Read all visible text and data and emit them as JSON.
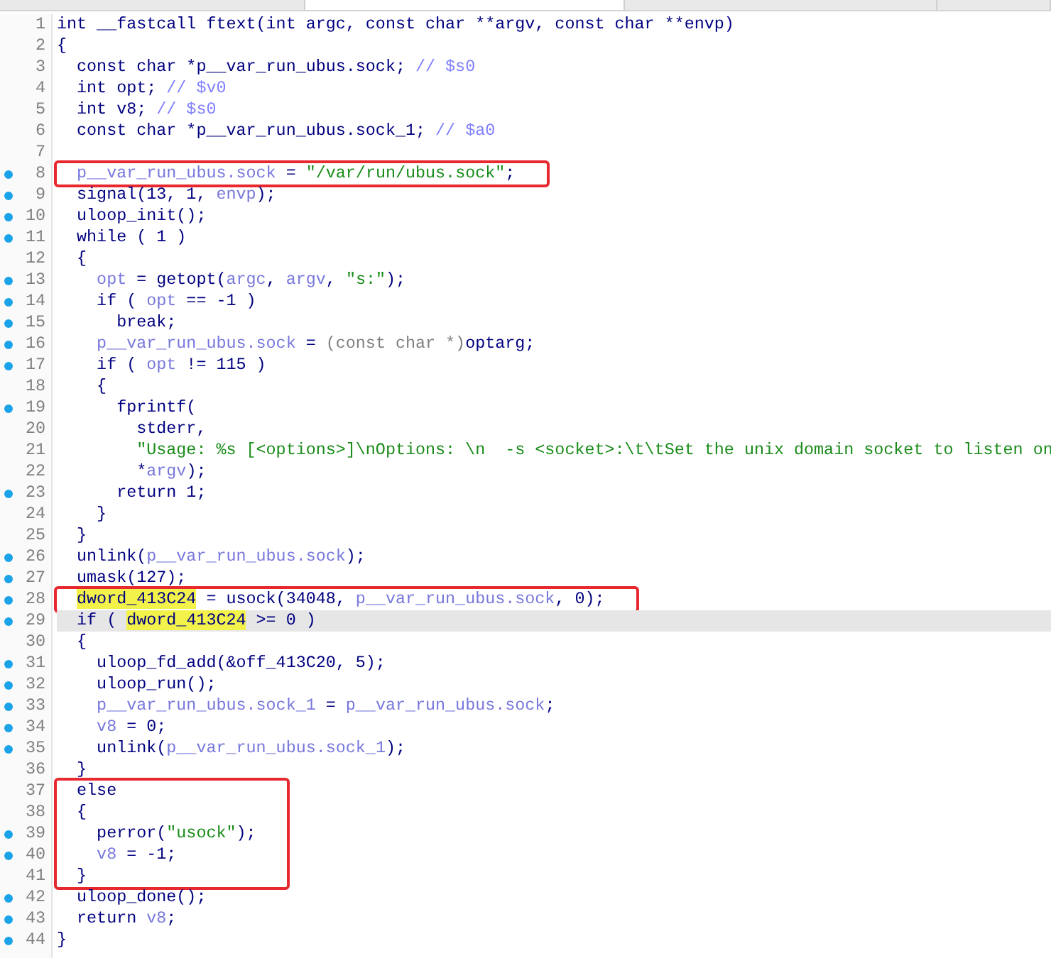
{
  "tabs": [
    {
      "selected": false
    },
    {
      "selected": true
    },
    {
      "selected": false
    },
    {
      "selected": false
    }
  ],
  "code": {
    "segments": [
      {
        "boxed": false,
        "lines": [
          {
            "number": "1",
            "breakpoint": false,
            "current": false,
            "tokens": [
              {
                "kind": "code",
                "text": "int __fastcall ftext(int argc, const char **argv, const char **envp)"
              }
            ]
          },
          {
            "number": "2",
            "breakpoint": false,
            "current": false,
            "tokens": [
              {
                "kind": "code",
                "text": "{"
              }
            ]
          },
          {
            "number": "3",
            "breakpoint": false,
            "current": false,
            "tokens": [
              {
                "kind": "code",
                "text": "  const char *p__var_run_ubus.sock; "
              },
              {
                "kind": "comment",
                "text": "// $s0"
              }
            ]
          },
          {
            "number": "4",
            "breakpoint": false,
            "current": false,
            "tokens": [
              {
                "kind": "code",
                "text": "  int opt; "
              },
              {
                "kind": "comment",
                "text": "// $v0"
              }
            ]
          },
          {
            "number": "5",
            "breakpoint": false,
            "current": false,
            "tokens": [
              {
                "kind": "code",
                "text": "  int v8; "
              },
              {
                "kind": "comment",
                "text": "// $s0"
              }
            ]
          },
          {
            "number": "6",
            "breakpoint": false,
            "current": false,
            "tokens": [
              {
                "kind": "code",
                "text": "  const char *p__var_run_ubus.sock_1; "
              },
              {
                "kind": "comment",
                "text": "// $a0"
              }
            ]
          },
          {
            "number": "7",
            "breakpoint": false,
            "current": false
          }
        ]
      },
      {
        "boxed": true,
        "lines": [
          {
            "number": "8",
            "breakpoint": true,
            "current": false,
            "tokens": [
              {
                "kind": "var",
                "text": "  p__var_run_ubus.sock"
              },
              {
                "kind": "code",
                "text": " = "
              },
              {
                "kind": "str",
                "text": "\"/var/run/ubus.sock\""
              },
              {
                "kind": "code",
                "text": ";"
              }
            ]
          }
        ]
      },
      {
        "boxed": false,
        "lines": [
          {
            "number": "9",
            "breakpoint": true,
            "current": false,
            "tokens": [
              {
                "kind": "code",
                "text": "  signal(13, 1, "
              },
              {
                "kind": "var",
                "text": "envp"
              },
              {
                "kind": "code",
                "text": ");"
              }
            ]
          },
          {
            "number": "10",
            "breakpoint": true,
            "current": false,
            "tokens": [
              {
                "kind": "code",
                "text": "  uloop_init();"
              }
            ]
          },
          {
            "number": "11",
            "breakpoint": true,
            "current": false,
            "tokens": [
              {
                "kind": "code",
                "text": "  while ( 1 )"
              }
            ]
          },
          {
            "number": "12",
            "breakpoint": false,
            "current": false,
            "tokens": [
              {
                "kind": "code",
                "text": "  {"
              }
            ]
          },
          {
            "number": "13",
            "breakpoint": true,
            "current": false,
            "tokens": [
              {
                "kind": "var",
                "text": "    opt"
              },
              {
                "kind": "code",
                "text": " = getopt("
              },
              {
                "kind": "var",
                "text": "argc"
              },
              {
                "kind": "code",
                "text": ", "
              },
              {
                "kind": "var",
                "text": "argv"
              },
              {
                "kind": "code",
                "text": ", "
              },
              {
                "kind": "str",
                "text": "\"s:\""
              },
              {
                "kind": "code",
                "text": ");"
              }
            ]
          },
          {
            "number": "14",
            "breakpoint": true,
            "current": false,
            "tokens": [
              {
                "kind": "code",
                "text": "    if ( "
              },
              {
                "kind": "var",
                "text": "opt"
              },
              {
                "kind": "code",
                "text": " == -1 )"
              }
            ]
          },
          {
            "number": "15",
            "breakpoint": true,
            "current": false,
            "tokens": [
              {
                "kind": "code",
                "text": "      break;"
              }
            ]
          },
          {
            "number": "16",
            "breakpoint": true,
            "current": false,
            "tokens": [
              {
                "kind": "var",
                "text": "    p__var_run_ubus.sock"
              },
              {
                "kind": "code",
                "text": " = "
              },
              {
                "kind": "cast",
                "text": "(const char *)"
              },
              {
                "kind": "code",
                "text": "optarg;"
              }
            ]
          },
          {
            "number": "17",
            "breakpoint": true,
            "current": false,
            "tokens": [
              {
                "kind": "code",
                "text": "    if ( "
              },
              {
                "kind": "var",
                "text": "opt"
              },
              {
                "kind": "code",
                "text": " != 115 )"
              }
            ]
          },
          {
            "number": "18",
            "breakpoint": false,
            "current": false,
            "tokens": [
              {
                "kind": "code",
                "text": "    {"
              }
            ]
          },
          {
            "number": "19",
            "breakpoint": true,
            "current": false,
            "tokens": [
              {
                "kind": "code",
                "text": "      fprintf("
              }
            ]
          },
          {
            "number": "20",
            "breakpoint": false,
            "current": false,
            "tokens": [
              {
                "kind": "code",
                "text": "        stderr,"
              }
            ]
          },
          {
            "number": "21",
            "breakpoint": false,
            "current": false,
            "tokens": [
              {
                "kind": "str",
                "text": "        \"Usage: %s [<options>]\\nOptions: \\n  -s <socket>:\\t\\tSet the unix domain socket to listen on"
              }
            ]
          },
          {
            "number": "22",
            "breakpoint": false,
            "current": false,
            "tokens": [
              {
                "kind": "code",
                "text": "        *"
              },
              {
                "kind": "var",
                "text": "argv"
              },
              {
                "kind": "code",
                "text": ");"
              }
            ]
          },
          {
            "number": "23",
            "breakpoint": true,
            "current": false,
            "tokens": [
              {
                "kind": "code",
                "text": "      return 1;"
              }
            ]
          },
          {
            "number": "24",
            "breakpoint": false,
            "current": false,
            "tokens": [
              {
                "kind": "code",
                "text": "    }"
              }
            ]
          },
          {
            "number": "25",
            "breakpoint": false,
            "current": false,
            "tokens": [
              {
                "kind": "code",
                "text": "  }"
              }
            ]
          },
          {
            "number": "26",
            "breakpoint": true,
            "current": false,
            "tokens": [
              {
                "kind": "code",
                "text": "  unlink("
              },
              {
                "kind": "var",
                "text": "p__var_run_ubus.sock"
              },
              {
                "kind": "code",
                "text": ");"
              }
            ]
          },
          {
            "number": "27",
            "breakpoint": true,
            "current": false,
            "tokens": [
              {
                "kind": "code",
                "text": "  umask(127);"
              }
            ]
          }
        ]
      },
      {
        "boxed": true,
        "lines": [
          {
            "number": "28",
            "breakpoint": true,
            "current": false,
            "tokens": [
              {
                "kind": "mark",
                "text": "  dword_413C24"
              },
              {
                "kind": "code",
                "text": " = usock(34048, "
              },
              {
                "kind": "var",
                "text": "p__var_run_ubus.sock"
              },
              {
                "kind": "code",
                "text": ", 0);"
              }
            ]
          }
        ]
      },
      {
        "boxed": false,
        "lines": [
          {
            "number": "29",
            "breakpoint": true,
            "current": true,
            "tokens": [
              {
                "kind": "code",
                "text": "  if ( "
              },
              {
                "kind": "mark",
                "text": "dword_413C24"
              },
              {
                "kind": "code",
                "text": " >= 0 )"
              }
            ]
          },
          {
            "number": "30",
            "breakpoint": false,
            "current": false,
            "tokens": [
              {
                "kind": "code",
                "text": "  {"
              }
            ]
          },
          {
            "number": "31",
            "breakpoint": true,
            "current": false,
            "tokens": [
              {
                "kind": "code",
                "text": "    uloop_fd_add(&off_413C20, 5);"
              }
            ]
          },
          {
            "number": "32",
            "breakpoint": true,
            "current": false,
            "tokens": [
              {
                "kind": "code",
                "text": "    uloop_run();"
              }
            ]
          },
          {
            "number": "33",
            "breakpoint": true,
            "current": false,
            "tokens": [
              {
                "kind": "var",
                "text": "    p__var_run_ubus.sock_1"
              },
              {
                "kind": "code",
                "text": " = "
              },
              {
                "kind": "var",
                "text": "p__var_run_ubus.sock"
              },
              {
                "kind": "code",
                "text": ";"
              }
            ]
          },
          {
            "number": "34",
            "breakpoint": true,
            "current": false,
            "tokens": [
              {
                "kind": "var",
                "text": "    v8"
              },
              {
                "kind": "code",
                "text": " = 0;"
              }
            ]
          },
          {
            "number": "35",
            "breakpoint": true,
            "current": false,
            "tokens": [
              {
                "kind": "code",
                "text": "    unlink("
              },
              {
                "kind": "var",
                "text": "p__var_run_ubus.sock_1"
              },
              {
                "kind": "code",
                "text": ");"
              }
            ]
          },
          {
            "number": "36",
            "breakpoint": false,
            "current": false,
            "tokens": [
              {
                "kind": "code",
                "text": "  }"
              }
            ]
          }
        ]
      },
      {
        "boxed": true,
        "lines": [
          {
            "number": "37",
            "breakpoint": false,
            "current": false,
            "tokens": [
              {
                "kind": "code",
                "text": "  else"
              }
            ]
          },
          {
            "number": "38",
            "breakpoint": false,
            "current": false,
            "tokens": [
              {
                "kind": "code",
                "text": "  {"
              }
            ]
          },
          {
            "number": "39",
            "breakpoint": true,
            "current": false,
            "tokens": [
              {
                "kind": "code",
                "text": "    perror("
              },
              {
                "kind": "str",
                "text": "\"usock\""
              },
              {
                "kind": "code",
                "text": ");"
              }
            ]
          },
          {
            "number": "40",
            "breakpoint": true,
            "current": false,
            "tokens": [
              {
                "kind": "var",
                "text": "    v8"
              },
              {
                "kind": "code",
                "text": " = -1;"
              }
            ]
          },
          {
            "number": "41",
            "breakpoint": false,
            "current": false,
            "tokens": [
              {
                "kind": "code",
                "text": "  }"
              }
            ]
          }
        ]
      },
      {
        "boxed": false,
        "lines": [
          {
            "number": "42",
            "breakpoint": true,
            "current": false,
            "tokens": [
              {
                "kind": "code",
                "text": "  uloop_done();"
              }
            ]
          },
          {
            "number": "43",
            "breakpoint": true,
            "current": false,
            "tokens": [
              {
                "kind": "code",
                "text": "  return "
              },
              {
                "kind": "var",
                "text": "v8"
              },
              {
                "kind": "code",
                "text": ";"
              }
            ]
          },
          {
            "number": "44",
            "breakpoint": true,
            "current": false,
            "tokens": [
              {
                "kind": "code",
                "text": "}"
              }
            ]
          }
        ]
      }
    ]
  }
}
